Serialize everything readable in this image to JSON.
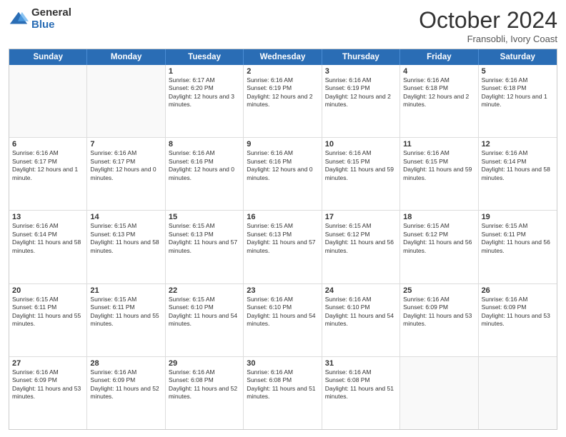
{
  "logo": {
    "general": "General",
    "blue": "Blue"
  },
  "header": {
    "month": "October 2024",
    "location": "Fransobli, Ivory Coast"
  },
  "days_of_week": [
    "Sunday",
    "Monday",
    "Tuesday",
    "Wednesday",
    "Thursday",
    "Friday",
    "Saturday"
  ],
  "weeks": [
    [
      {
        "day": "",
        "empty": true,
        "text": ""
      },
      {
        "day": "",
        "empty": true,
        "text": ""
      },
      {
        "day": "1",
        "text": "Sunrise: 6:17 AM\nSunset: 6:20 PM\nDaylight: 12 hours and 3 minutes."
      },
      {
        "day": "2",
        "text": "Sunrise: 6:16 AM\nSunset: 6:19 PM\nDaylight: 12 hours and 2 minutes."
      },
      {
        "day": "3",
        "text": "Sunrise: 6:16 AM\nSunset: 6:19 PM\nDaylight: 12 hours and 2 minutes."
      },
      {
        "day": "4",
        "text": "Sunrise: 6:16 AM\nSunset: 6:18 PM\nDaylight: 12 hours and 2 minutes."
      },
      {
        "day": "5",
        "text": "Sunrise: 6:16 AM\nSunset: 6:18 PM\nDaylight: 12 hours and 1 minute."
      }
    ],
    [
      {
        "day": "6",
        "text": "Sunrise: 6:16 AM\nSunset: 6:17 PM\nDaylight: 12 hours and 1 minute."
      },
      {
        "day": "7",
        "text": "Sunrise: 6:16 AM\nSunset: 6:17 PM\nDaylight: 12 hours and 0 minutes."
      },
      {
        "day": "8",
        "text": "Sunrise: 6:16 AM\nSunset: 6:16 PM\nDaylight: 12 hours and 0 minutes."
      },
      {
        "day": "9",
        "text": "Sunrise: 6:16 AM\nSunset: 6:16 PM\nDaylight: 12 hours and 0 minutes."
      },
      {
        "day": "10",
        "text": "Sunrise: 6:16 AM\nSunset: 6:15 PM\nDaylight: 11 hours and 59 minutes."
      },
      {
        "day": "11",
        "text": "Sunrise: 6:16 AM\nSunset: 6:15 PM\nDaylight: 11 hours and 59 minutes."
      },
      {
        "day": "12",
        "text": "Sunrise: 6:16 AM\nSunset: 6:14 PM\nDaylight: 11 hours and 58 minutes."
      }
    ],
    [
      {
        "day": "13",
        "text": "Sunrise: 6:16 AM\nSunset: 6:14 PM\nDaylight: 11 hours and 58 minutes."
      },
      {
        "day": "14",
        "text": "Sunrise: 6:15 AM\nSunset: 6:13 PM\nDaylight: 11 hours and 58 minutes."
      },
      {
        "day": "15",
        "text": "Sunrise: 6:15 AM\nSunset: 6:13 PM\nDaylight: 11 hours and 57 minutes."
      },
      {
        "day": "16",
        "text": "Sunrise: 6:15 AM\nSunset: 6:13 PM\nDaylight: 11 hours and 57 minutes."
      },
      {
        "day": "17",
        "text": "Sunrise: 6:15 AM\nSunset: 6:12 PM\nDaylight: 11 hours and 56 minutes."
      },
      {
        "day": "18",
        "text": "Sunrise: 6:15 AM\nSunset: 6:12 PM\nDaylight: 11 hours and 56 minutes."
      },
      {
        "day": "19",
        "text": "Sunrise: 6:15 AM\nSunset: 6:11 PM\nDaylight: 11 hours and 56 minutes."
      }
    ],
    [
      {
        "day": "20",
        "text": "Sunrise: 6:15 AM\nSunset: 6:11 PM\nDaylight: 11 hours and 55 minutes."
      },
      {
        "day": "21",
        "text": "Sunrise: 6:15 AM\nSunset: 6:11 PM\nDaylight: 11 hours and 55 minutes."
      },
      {
        "day": "22",
        "text": "Sunrise: 6:15 AM\nSunset: 6:10 PM\nDaylight: 11 hours and 54 minutes."
      },
      {
        "day": "23",
        "text": "Sunrise: 6:16 AM\nSunset: 6:10 PM\nDaylight: 11 hours and 54 minutes."
      },
      {
        "day": "24",
        "text": "Sunrise: 6:16 AM\nSunset: 6:10 PM\nDaylight: 11 hours and 54 minutes."
      },
      {
        "day": "25",
        "text": "Sunrise: 6:16 AM\nSunset: 6:09 PM\nDaylight: 11 hours and 53 minutes."
      },
      {
        "day": "26",
        "text": "Sunrise: 6:16 AM\nSunset: 6:09 PM\nDaylight: 11 hours and 53 minutes."
      }
    ],
    [
      {
        "day": "27",
        "text": "Sunrise: 6:16 AM\nSunset: 6:09 PM\nDaylight: 11 hours and 53 minutes."
      },
      {
        "day": "28",
        "text": "Sunrise: 6:16 AM\nSunset: 6:09 PM\nDaylight: 11 hours and 52 minutes."
      },
      {
        "day": "29",
        "text": "Sunrise: 6:16 AM\nSunset: 6:08 PM\nDaylight: 11 hours and 52 minutes."
      },
      {
        "day": "30",
        "text": "Sunrise: 6:16 AM\nSunset: 6:08 PM\nDaylight: 11 hours and 51 minutes."
      },
      {
        "day": "31",
        "text": "Sunrise: 6:16 AM\nSunset: 6:08 PM\nDaylight: 11 hours and 51 minutes."
      },
      {
        "day": "",
        "empty": true,
        "text": ""
      },
      {
        "day": "",
        "empty": true,
        "text": ""
      }
    ]
  ]
}
